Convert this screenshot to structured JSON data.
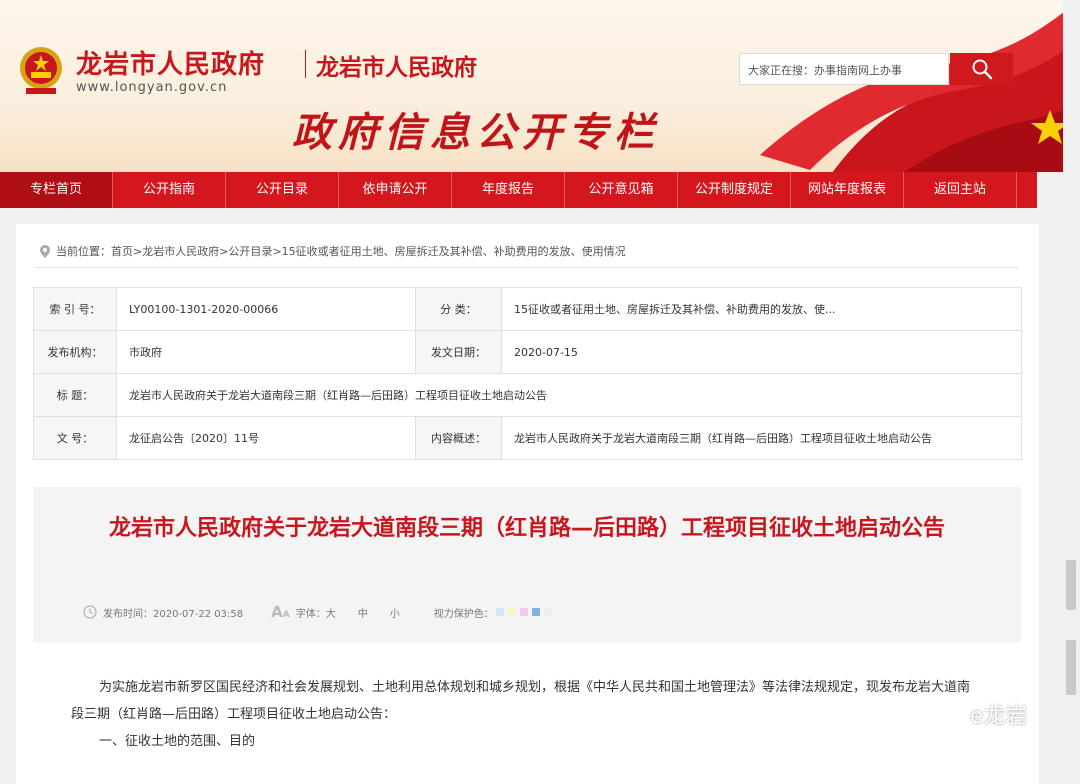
{
  "header": {
    "site_name": "龙岩市人民政府",
    "site_name_secondary": "龙岩市人民政府",
    "site_url": "www.longyan.gov.cn",
    "banner_title": "政府信息公开专栏",
    "search_placeholder": "大家正在搜：办事指南网上办事"
  },
  "nav": {
    "items": [
      "专栏首页",
      "公开指南",
      "公开目录",
      "依申请公开",
      "年度报告",
      "公开意见箱",
      "公开制度规定",
      "网站年度报表",
      "返回主站"
    ],
    "active_index": 0
  },
  "breadcrumb": {
    "prefix": "当前位置：",
    "items": [
      "首页",
      "龙岩市人民政府",
      "公开目录",
      "15征收或者征用土地、房屋拆迁及其补偿、补助费用的发放、使用情况"
    ],
    "separator": " > "
  },
  "meta_table": {
    "index_label": "索 引 号：",
    "index_value": "LY00100-1301-2020-00066",
    "category_label": "分 类：",
    "category_value": "15征收或者征用土地、房屋拆迁及其补偿、补助费用的发放、使...",
    "publisher_label": "发布机构：",
    "publisher_value": "市政府",
    "date_label": "发文日期：",
    "date_value": "2020-07-15",
    "title_label": "标 题：",
    "title_value": "龙岩市人民政府关于龙岩大道南段三期（红肖路—后田路）工程项目征收土地启动公告",
    "docno_label": "文 号：",
    "docno_value": "龙征启公告〔2020〕11号",
    "summary_label": "内容概述：",
    "summary_value": "龙岩市人民政府关于龙岩大道南段三期（红肖路—后田路）工程项目征收土地启动公告"
  },
  "article": {
    "title": "龙岩市人民政府关于龙岩大道南段三期（红肖路—后田路）工程项目征收土地启动公告",
    "publish_time": "发布时间：2020-07-22 03:58",
    "font_label": "字体：",
    "font_large": "大",
    "font_medium": "中",
    "font_small": "小",
    "eye_label": "视力保护色：",
    "eye_colors": [
      "#cfe9f7",
      "#f6f3c6",
      "#f3c9ea",
      "#7fb0e0",
      "#eeeeee"
    ],
    "paragraph1": "为实施龙岩市新罗区国民经济和社会发展规划、土地利用总体规划和城乡规划，根据《中华人民共和国土地管理法》等法律法规规定，现发布龙岩大道南段三期（红肖路—后田路）工程项目征收土地启动公告：",
    "section1": "一、征收土地的范围、目的"
  },
  "watermark": {
    "text": "e龙岩"
  },
  "colors": {
    "brand_red": "#d3171d",
    "title_red": "#c8161d"
  }
}
